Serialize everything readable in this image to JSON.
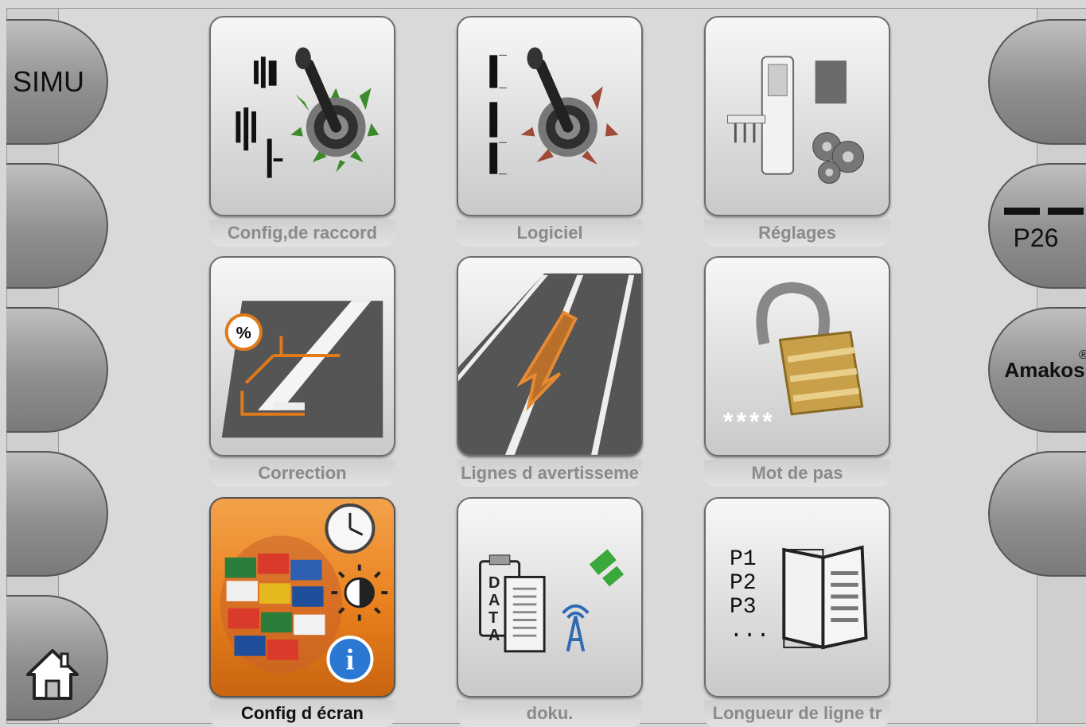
{
  "left_softkeys": [
    {
      "label": "SIMU"
    },
    {
      "label": ""
    },
    {
      "label": ""
    },
    {
      "label": ""
    },
    {
      "icon": "home-icon"
    }
  ],
  "right_softkeys": [
    {
      "label": ""
    },
    {
      "label": "P26"
    },
    {
      "label": "Amakos",
      "superscript": "®"
    },
    {
      "label": ""
    }
  ],
  "tiles": [
    {
      "label": "Config,de raccord",
      "icon": "joystick-config-icon",
      "selected": false
    },
    {
      "label": "Logiciel",
      "icon": "joystick-software-icon",
      "selected": false
    },
    {
      "label": "Réglages",
      "icon": "settings-machine-gears-icon",
      "selected": false
    },
    {
      "label": "Correction",
      "icon": "correction-percent-road-icon",
      "selected": false
    },
    {
      "label": "Lignes d avertisseme",
      "icon": "warning-lines-road-icon",
      "selected": false
    },
    {
      "label": "Mot de pas",
      "icon": "padlock-icon",
      "password_mask": "****",
      "selected": false
    },
    {
      "label": "Config d écran",
      "icon": "globe-flags-clock-icon",
      "selected": true
    },
    {
      "label": "doku.",
      "icon": "data-satellite-icon",
      "data_text": "DATA",
      "selected": false
    },
    {
      "label": "Longueur de ligne tr",
      "icon": "book-p-list-icon",
      "list": [
        "P1",
        "P2",
        "P3",
        "..."
      ],
      "selected": false
    }
  ],
  "colors": {
    "selected_tile": "#e9801d",
    "background": "#d9d9d9"
  }
}
